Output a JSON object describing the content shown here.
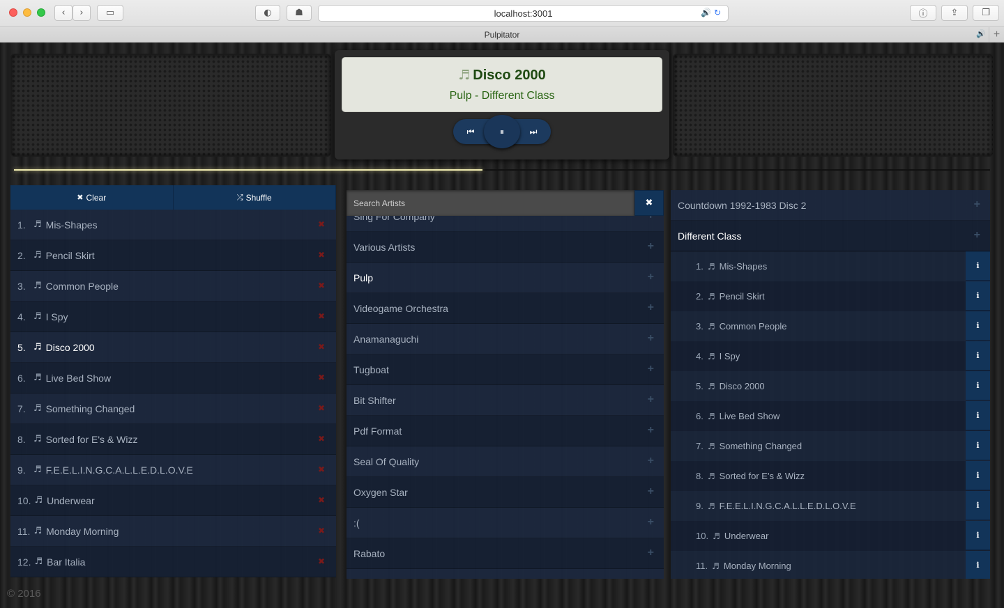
{
  "browser": {
    "url": "localhost:3001",
    "tab_title": "Pulpitator"
  },
  "now_playing": {
    "title": "Disco 2000",
    "subtitle": "Pulp - Different Class",
    "progress_percent": 48
  },
  "queue": {
    "clear_label": "Clear",
    "shuffle_label": "Shuffle",
    "items": [
      {
        "num": "1.",
        "title": "Mis-Shapes"
      },
      {
        "num": "2.",
        "title": "Pencil Skirt"
      },
      {
        "num": "3.",
        "title": "Common People"
      },
      {
        "num": "4.",
        "title": "I Spy"
      },
      {
        "num": "5.",
        "title": "Disco 2000"
      },
      {
        "num": "6.",
        "title": "Live Bed Show"
      },
      {
        "num": "7.",
        "title": "Something Changed"
      },
      {
        "num": "8.",
        "title": "Sorted for E's & Wizz"
      },
      {
        "num": "9.",
        "title": "F.E.E.L.I.N.G.C.A.L.L.E.D.L.O.V.E"
      },
      {
        "num": "10.",
        "title": "Underwear"
      },
      {
        "num": "11.",
        "title": "Monday Morning"
      },
      {
        "num": "12.",
        "title": "Bar Italia"
      }
    ]
  },
  "artists": {
    "search_placeholder": "Search Artists",
    "items": [
      {
        "name": "Sing For Company"
      },
      {
        "name": "Various Artists"
      },
      {
        "name": "Pulp"
      },
      {
        "name": "Videogame Orchestra"
      },
      {
        "name": "Anamanaguchi"
      },
      {
        "name": "Tugboat"
      },
      {
        "name": "Bit Shifter"
      },
      {
        "name": "Pdf Format"
      },
      {
        "name": "Seal Of Quality"
      },
      {
        "name": "Oxygen Star"
      },
      {
        "name": ":("
      },
      {
        "name": "Rabato"
      },
      {
        "name": ""
      }
    ]
  },
  "albums": {
    "items": [
      {
        "name": "Countdown 1992-1983 Disc 2"
      },
      {
        "name": "Different Class"
      }
    ],
    "tracks": [
      {
        "num": "1.",
        "title": "Mis-Shapes"
      },
      {
        "num": "2.",
        "title": "Pencil Skirt"
      },
      {
        "num": "3.",
        "title": "Common People"
      },
      {
        "num": "4.",
        "title": "I Spy"
      },
      {
        "num": "5.",
        "title": "Disco 2000"
      },
      {
        "num": "6.",
        "title": "Live Bed Show"
      },
      {
        "num": "7.",
        "title": "Something Changed"
      },
      {
        "num": "8.",
        "title": "Sorted for E's & Wizz"
      },
      {
        "num": "9.",
        "title": "F.E.E.L.I.N.G.C.A.L.L.E.D.L.O.V.E"
      },
      {
        "num": "10.",
        "title": "Underwear"
      },
      {
        "num": "11.",
        "title": "Monday Morning"
      }
    ]
  },
  "footer": {
    "text": "© 2016"
  }
}
